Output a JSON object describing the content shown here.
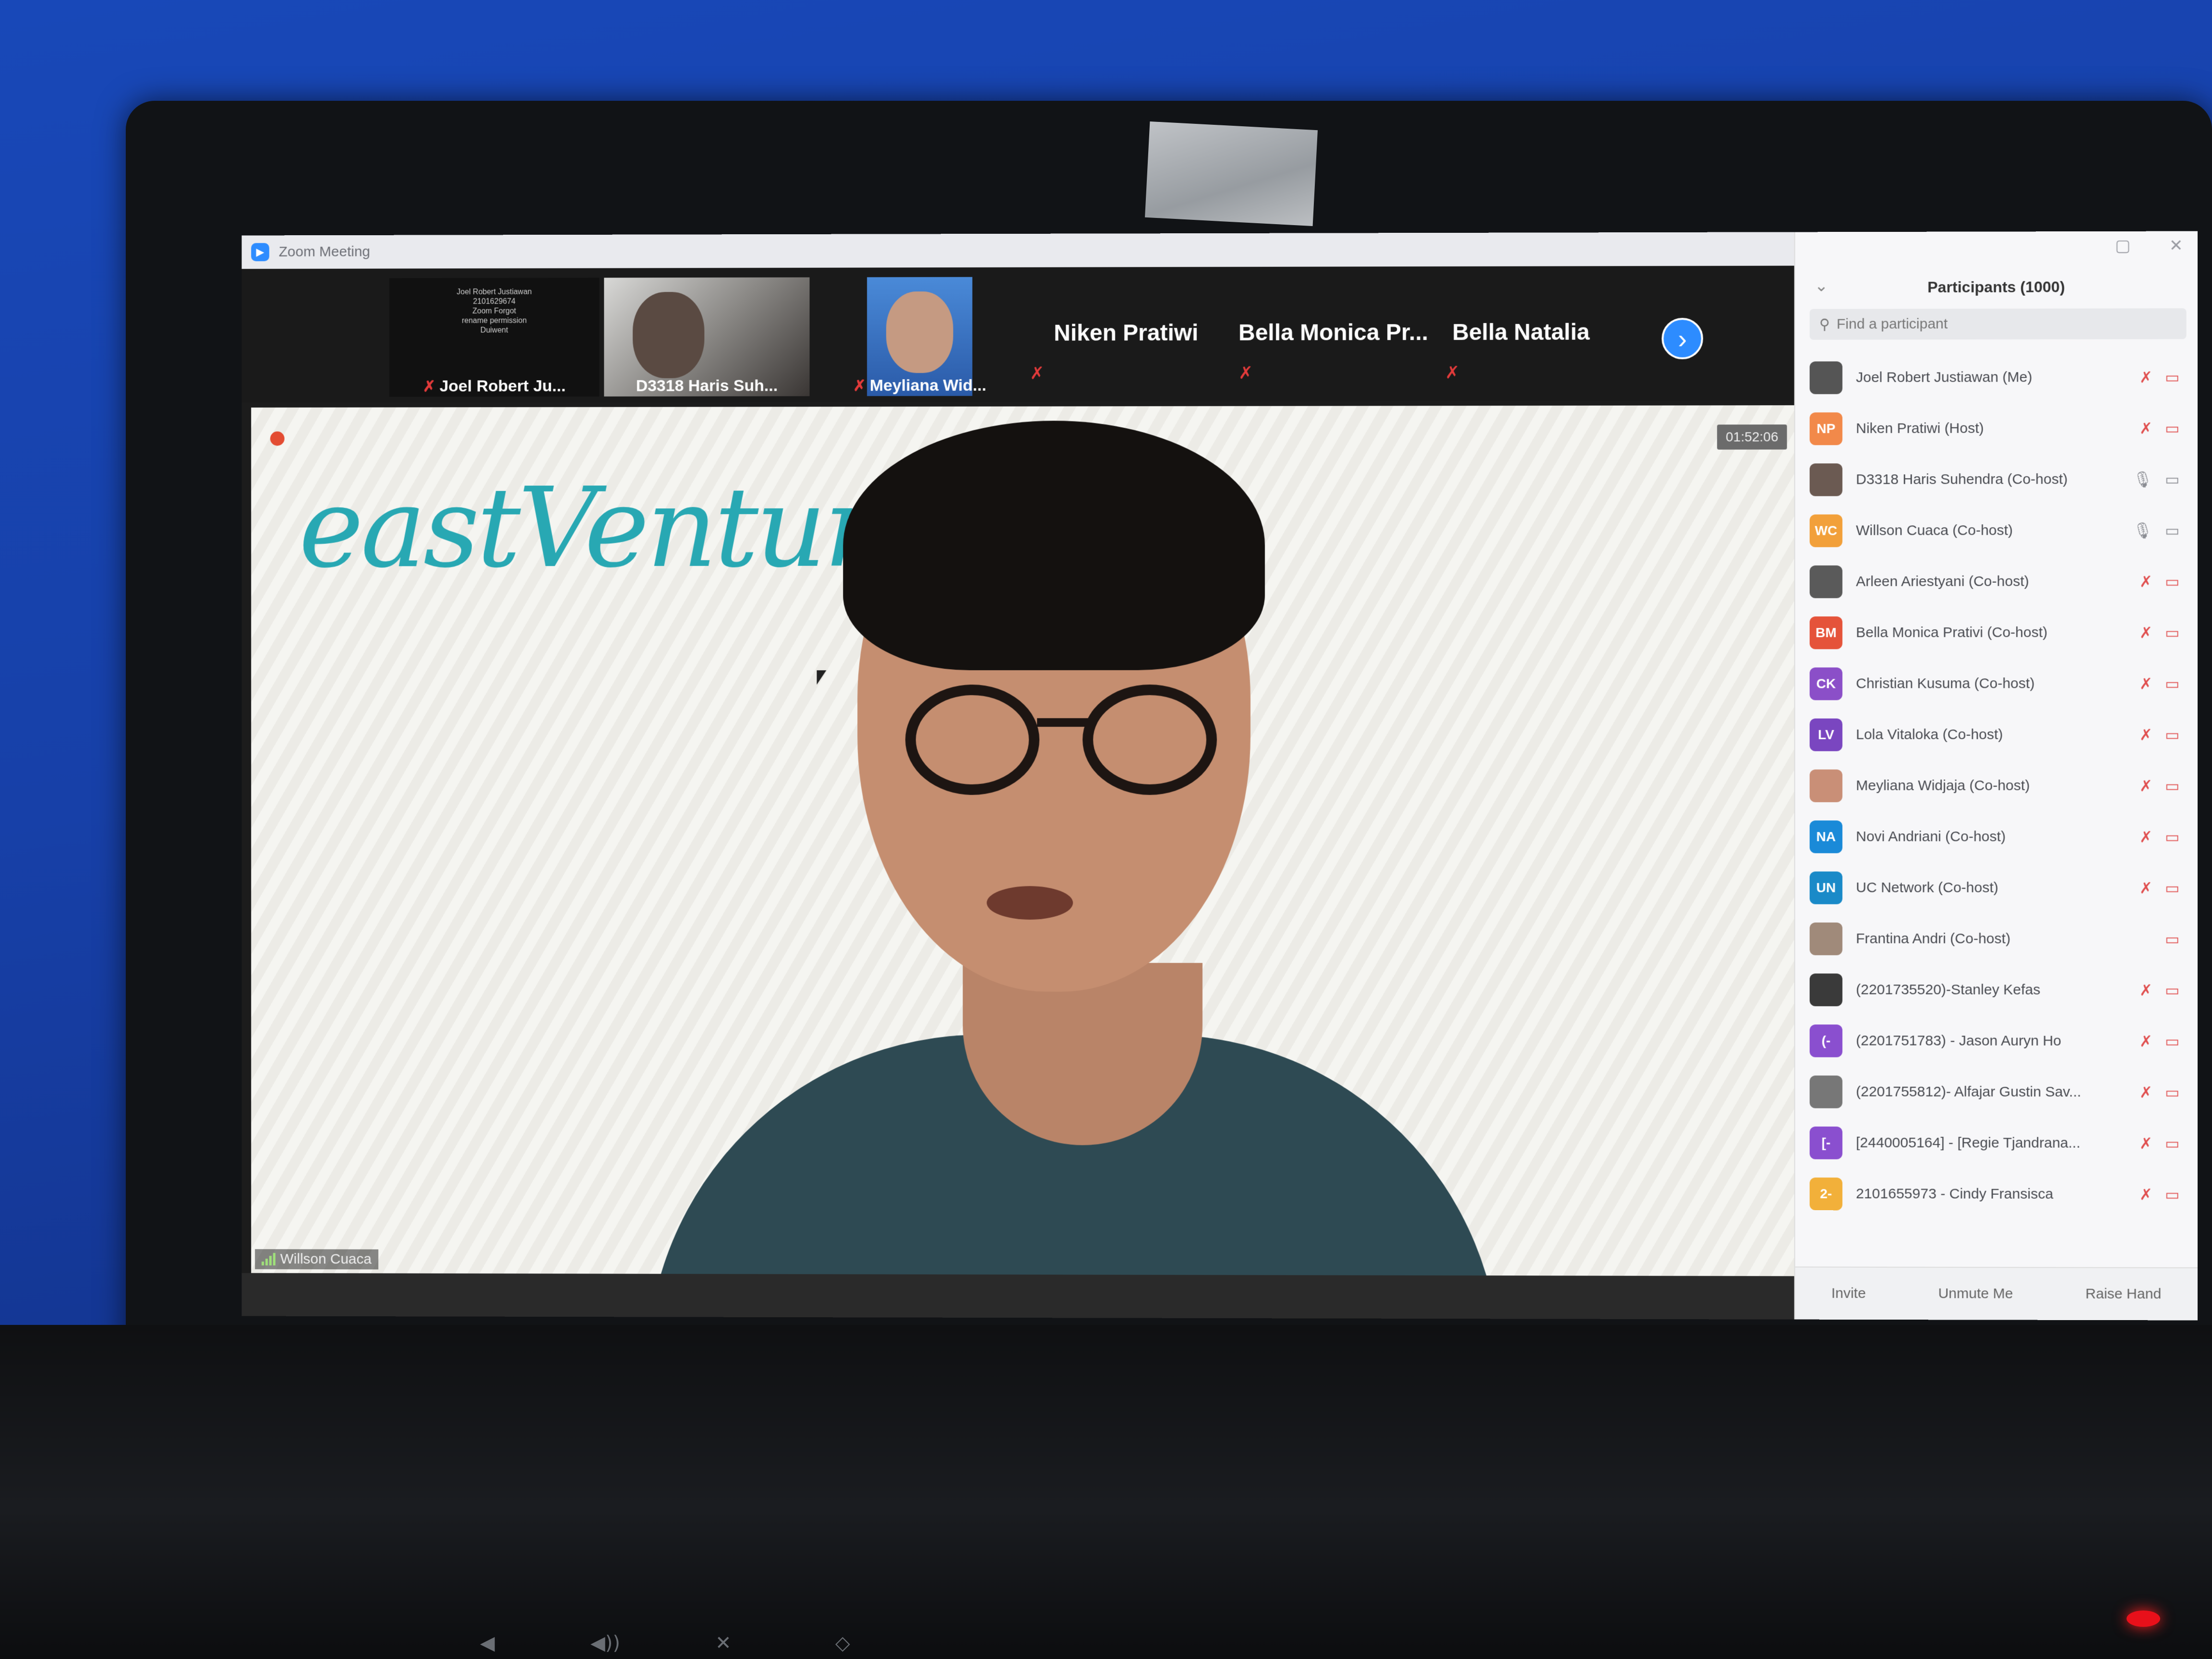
{
  "window": {
    "title": "Zoom Meeting"
  },
  "gallery": {
    "tiles": [
      {
        "label": "Joel Robert Ju...",
        "muted": true,
        "overlay": [
          "Joel Robert Justiawan",
          "2101629674",
          "Zoom Forgot",
          "rename permission",
          "Duiwent"
        ]
      },
      {
        "label": "D3318 Haris Suh...",
        "muted": false
      },
      {
        "label": "Meyliana Wid...",
        "muted": true
      }
    ],
    "name_tiles": [
      "Niken Pratiwi",
      "Bella Monica Pr...",
      "Bella Natalia"
    ],
    "next_icon": "chevron-right-icon"
  },
  "main_video": {
    "logo_text": "eastVentures",
    "timer": "01:52:06",
    "speaker": "Willson Cuaca"
  },
  "participants_panel": {
    "title": "Participants (1000)",
    "search_placeholder": "Find a participant",
    "participants": [
      {
        "initials": "",
        "color": "#555555",
        "name": "Joel Robert Justiawan (Me)"
      },
      {
        "initials": "NP",
        "color": "#f2894a",
        "name": "Niken Pratiwi (Host)"
      },
      {
        "initials": "",
        "color": "#6b5a52",
        "name": "D3318 Haris Suhendra (Co-host)"
      },
      {
        "initials": "WC",
        "color": "#f2a03a",
        "name": "Willson Cuaca (Co-host)"
      },
      {
        "initials": "",
        "color": "#5a5a5a",
        "name": "Arleen Ariestyani (Co-host)"
      },
      {
        "initials": "BM",
        "color": "#e5533a",
        "name": "Bella Monica Prativi (Co-host)"
      },
      {
        "initials": "CK",
        "color": "#8b4fc8",
        "name": "Christian Kusuma (Co-host)"
      },
      {
        "initials": "LV",
        "color": "#7a46c0",
        "name": "Lola Vitaloka (Co-host)"
      },
      {
        "initials": "",
        "color": "#c98f77",
        "name": "Meyliana Widjaja (Co-host)"
      },
      {
        "initials": "NA",
        "color": "#1a8ad8",
        "name": "Novi Andriani (Co-host)"
      },
      {
        "initials": "UN",
        "color": "#1a8ac8",
        "name": "UC Network (Co-host)"
      },
      {
        "initials": "",
        "color": "#a08a7a",
        "name": "Frantina Andri (Co-host)"
      },
      {
        "initials": "",
        "color": "#3a3a3a",
        "name": "(2201735520)-Stanley Kefas"
      },
      {
        "initials": "(-",
        "color": "#8a4fcf",
        "name": "(2201751783) - Jason Auryn Ho"
      },
      {
        "initials": "",
        "color": "#777777",
        "name": "(2201755812)- Alfajar Gustin Sav..."
      },
      {
        "initials": "[-",
        "color": "#8a4fcf",
        "name": "[2440005164] - [Regie Tjandrana..."
      },
      {
        "initials": "2-",
        "color": "#f2b03a",
        "name": "2101655973 - Cindy Fransisca"
      }
    ],
    "footer": {
      "invite": "Invite",
      "unmute": "Unmute Me",
      "raise_hand": "Raise Hand"
    }
  }
}
